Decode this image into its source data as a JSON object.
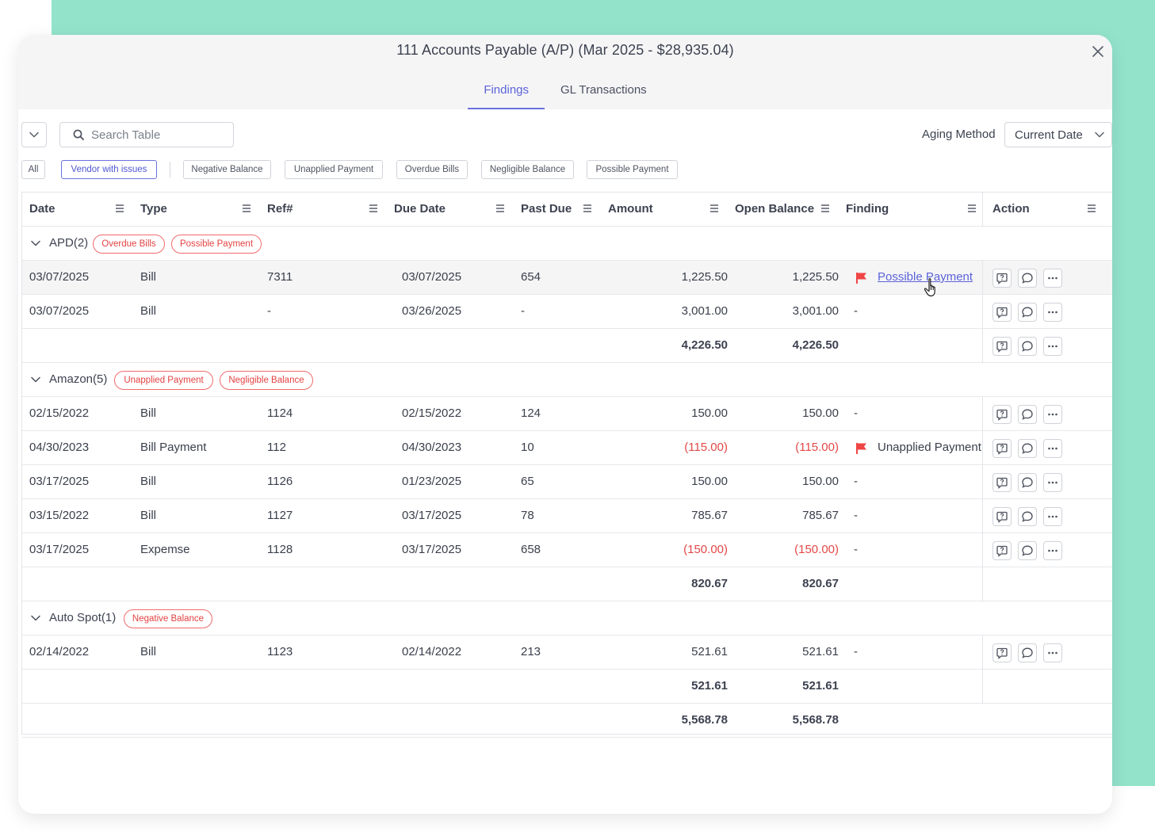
{
  "modal": {
    "title": "111 Accounts Payable (A/P) (Mar 2025 - $28,935.04)",
    "tabs": [
      {
        "label": "Findings",
        "active": true
      },
      {
        "label": "GL Transactions",
        "active": false
      }
    ]
  },
  "toolbar": {
    "search_placeholder": "Search Table",
    "aging_label": "Aging Method",
    "aging_value": "Current Date"
  },
  "filters": [
    "All",
    "Vendor with issues",
    "Negative Balance",
    "Unapplied Payment",
    "Overdue Bills",
    "Negligible Balance",
    "Possible Payment"
  ],
  "active_filter": "Vendor with issues",
  "columns": [
    "Date",
    "Type",
    "Ref#",
    "Due Date",
    "Past Due",
    "Amount",
    "Open Balance",
    "Finding",
    "Action"
  ],
  "groups": [
    {
      "name": "APD(2)",
      "tags": [
        "Overdue Bills",
        "Possible Payment"
      ],
      "rows": [
        {
          "date": "03/07/2025",
          "type": "Bill",
          "ref": "7311",
          "due": "03/07/2025",
          "past_due": "654",
          "amount": "1,225.50",
          "open": "1,225.50",
          "finding": "Possible Payment"
        },
        {
          "date": "03/07/2025",
          "type": "Bill",
          "ref": "-",
          "due": "03/26/2025",
          "past_due": "-",
          "amount": "3,001.00",
          "open": "3,001.00",
          "finding": "-"
        }
      ],
      "total_amount": "4,226.50",
      "total_open": "4,226.50"
    },
    {
      "name": "Amazon(5)",
      "tags": [
        "Unapplied Payment",
        "Negligible Balance"
      ],
      "rows": [
        {
          "date": "02/15/2022",
          "type": "Bill",
          "ref": "1124",
          "due": "02/15/2022",
          "past_due": "124",
          "amount": "150.00",
          "open": "150.00",
          "finding": "-"
        },
        {
          "date": "04/30/2023",
          "type": "Bill Payment",
          "ref": "112",
          "due": "04/30/2023",
          "past_due": "10",
          "amount": "(115.00)",
          "open": "(115.00)",
          "finding": "Unapplied Payment"
        },
        {
          "date": "03/17/2025",
          "type": "Bill",
          "ref": "1126",
          "due": "01/23/2025",
          "past_due": "65",
          "amount": "150.00",
          "open": "150.00",
          "finding": "-"
        },
        {
          "date": "03/15/2022",
          "type": "Bill",
          "ref": "1127",
          "due": "03/17/2025",
          "past_due": "78",
          "amount": "785.67",
          "open": "785.67",
          "finding": "-"
        },
        {
          "date": "03/17/2025",
          "type": "Expemse",
          "ref": "1128",
          "due": "03/17/2025",
          "past_due": "658",
          "amount": "(150.00)",
          "open": "(150.00)",
          "finding": "-"
        }
      ],
      "total_amount": "820.67",
      "total_open": "820.67"
    },
    {
      "name": "Auto Spot(1)",
      "tags": [
        "Negative Balance"
      ],
      "rows": [
        {
          "date": "02/14/2022",
          "type": "Bill",
          "ref": "1123",
          "due": "02/14/2022",
          "past_due": "213",
          "amount": "521.61",
          "open": "521.61",
          "finding": "-"
        }
      ],
      "total_amount": "521.61",
      "total_open": "521.61"
    }
  ],
  "grand_total": {
    "amount": "5,568.78",
    "open": "5,568.78"
  },
  "colors": {
    "accent": "#5b63d8",
    "negative": "#e34848",
    "flag": "#f04545",
    "background_accent": "#93e3cb"
  }
}
